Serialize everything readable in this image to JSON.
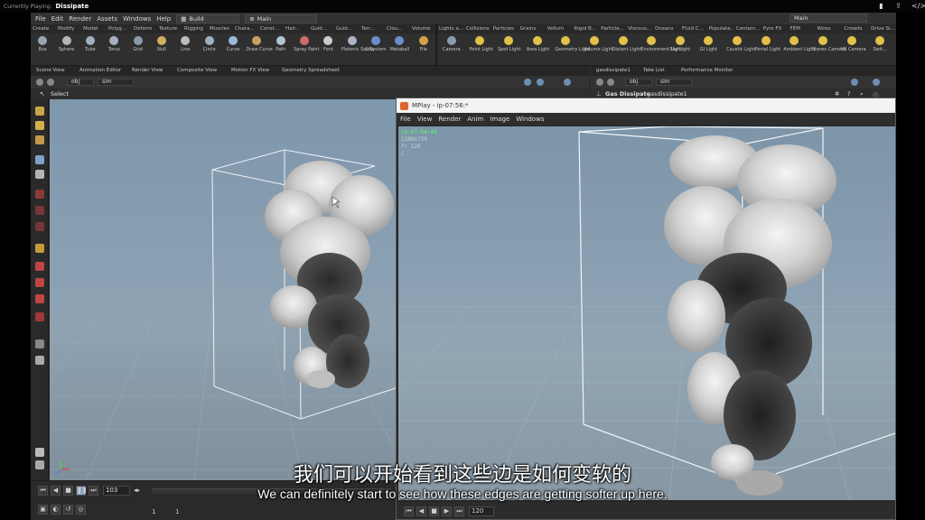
{
  "player": {
    "label": "Currently Playing:",
    "title": "Dissipate"
  },
  "menubar": {
    "items": [
      "File",
      "Edit",
      "Render",
      "Assets",
      "Windows",
      "Help"
    ],
    "desktop": "Build",
    "context": "Main",
    "right_context": "Main"
  },
  "shelf_tabs_left": [
    "Create",
    "Modify",
    "Model",
    "Polyg...",
    "Deform",
    "Texture",
    "Rigging",
    "Muscles",
    "Chara...",
    "Const...",
    "Hair...",
    "Guid...",
    "Guid...",
    "Terr...",
    "Clou...",
    "Volume"
  ],
  "shelf_tabs_right": [
    "Lights a...",
    "Collisions",
    "Particles",
    "Grains",
    "Vellum",
    "Rigid B...",
    "Particle...",
    "Viscous...",
    "Oceans",
    "Fluid C...",
    "Populate...",
    "Contain...",
    "Pyro FX",
    "FEM",
    "Wires",
    "Crowds",
    "Drive Si..."
  ],
  "shelf_tools_left": [
    "Box",
    "Sphere",
    "Tube",
    "Torus",
    "Grid",
    "Null",
    "Line",
    "Circle",
    "Curve",
    "Draw Curve",
    "Path",
    "Spray Paint",
    "Font",
    "Platonic Solids",
    "L-System",
    "Metaball",
    "File"
  ],
  "shelf_tools_right": [
    "Camera",
    "Point Light",
    "Spot Light",
    "Area Light",
    "Geometry Light",
    "Volume Light",
    "Distant Light",
    "Environment Light",
    "Sky Light",
    "GI Light",
    "Caustic Light",
    "Portal Light",
    "Ambient Light",
    "Stereo Camera",
    "VR Camera",
    "Swit..."
  ],
  "pane_tabs_left": [
    "Scene View",
    "Animation Editor",
    "Render View",
    "Composite View",
    "Motion FX View",
    "Geometry Spreadsheet"
  ],
  "pane_tabs_right": [
    "gasdissipate1",
    "Take List",
    "Performance Monitor"
  ],
  "path_left": {
    "root": "obj",
    "node": "sim"
  },
  "path_right": {
    "root": "obj",
    "node": "sim"
  },
  "opbar_left": {
    "tool": "Select"
  },
  "opbar_right": {
    "type": "Gas Dissipate",
    "name": "gasdissipate1"
  },
  "mplay": {
    "title": "MPlay - ip-07:56:*",
    "menus": [
      "File",
      "View",
      "Render",
      "Anim",
      "Image",
      "Windows"
    ],
    "stats": {
      "line1": "ip-07:54:45",
      "line2": "1280x720",
      "line3": "fr 120",
      "line4": "C"
    },
    "frame": "120"
  },
  "timeline": {
    "frame": "103",
    "start": "1",
    "end": "1"
  },
  "subtitles": {
    "cn": "我们可以开始看到这些边是如何变软的",
    "en": "We can definitely start to see how these edges are getting softer up here."
  }
}
